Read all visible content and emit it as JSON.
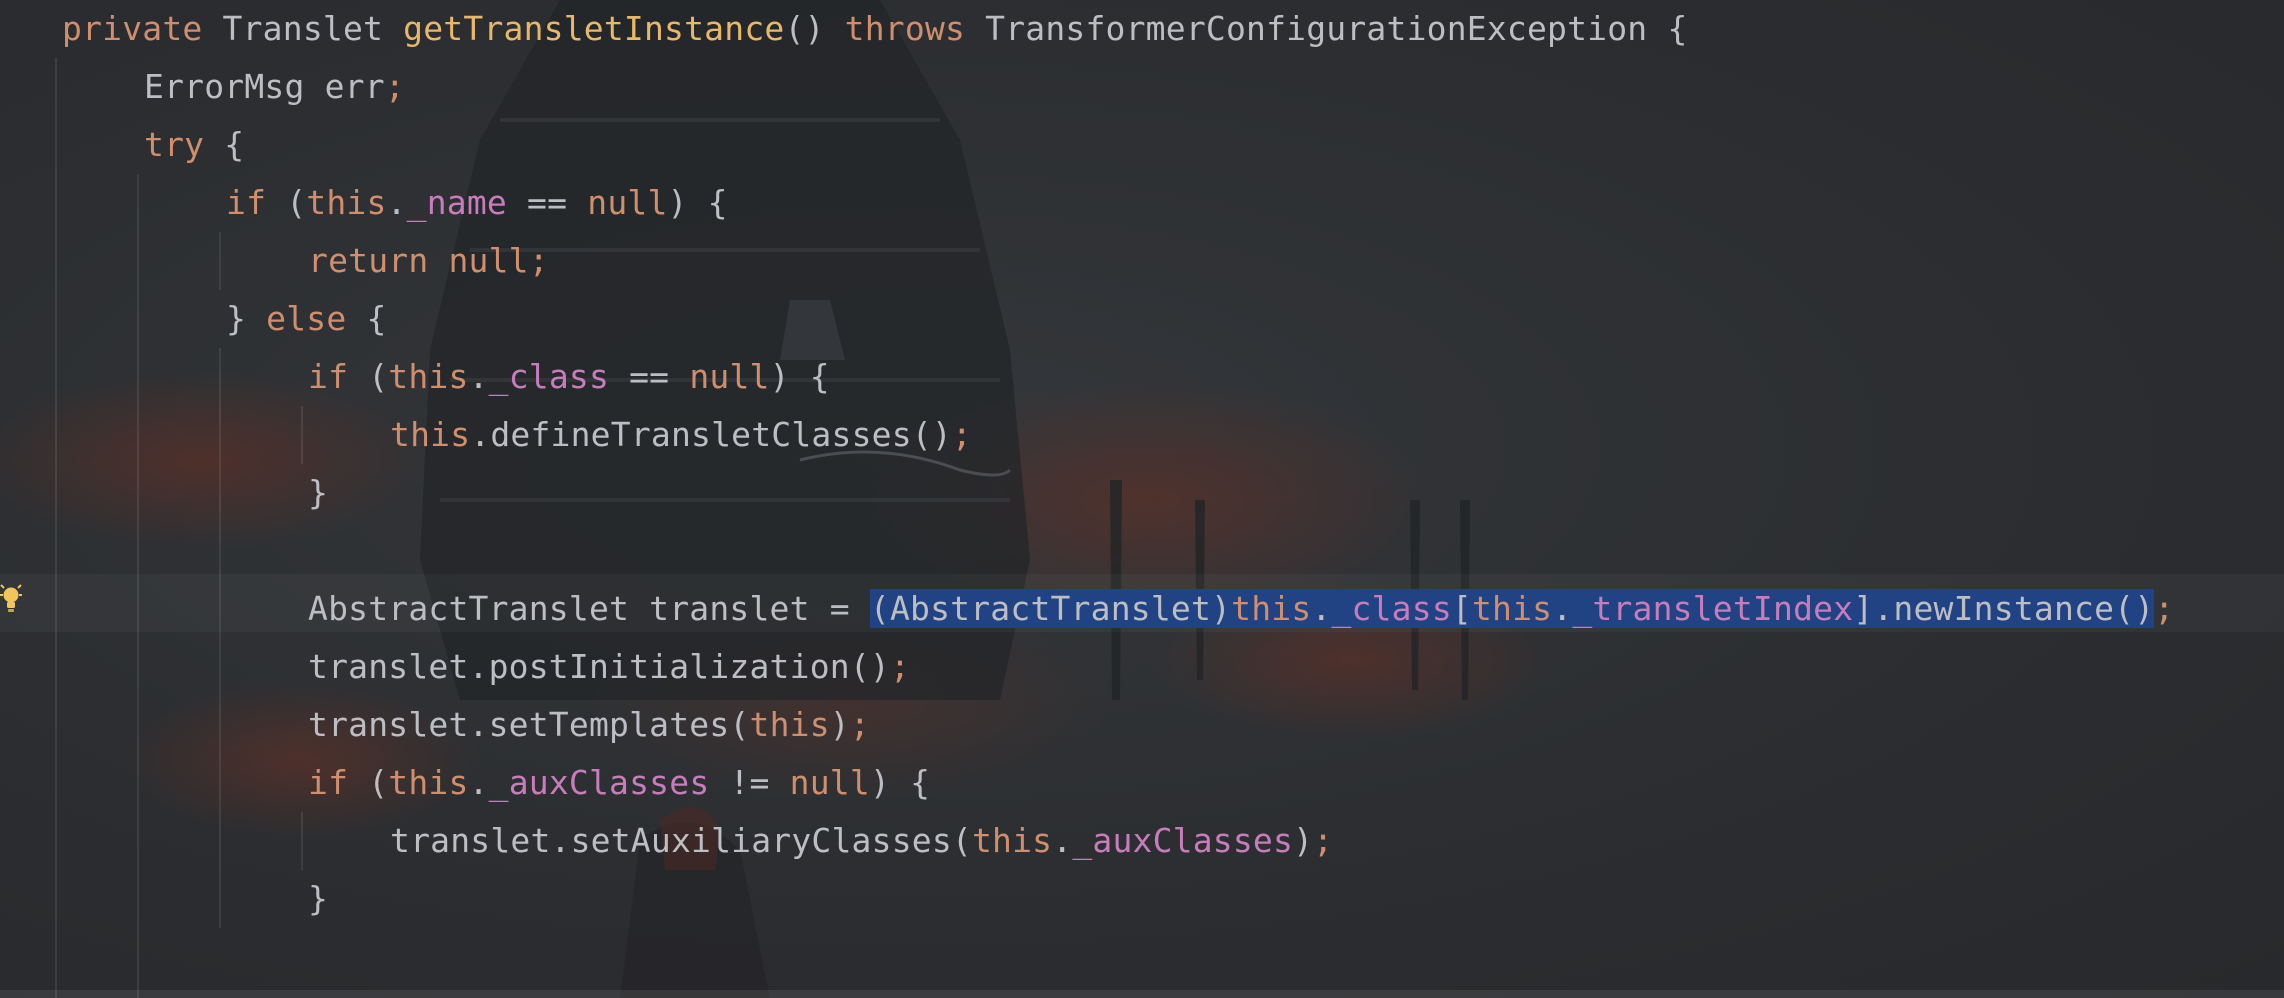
{
  "editor": {
    "language": "java",
    "colors": {
      "background": "#2b2d30",
      "keyword": "#cf8e6d",
      "method_decl": "#e8b86a",
      "field": "#c77dbb",
      "plain": "#bcbec4",
      "selection": "#214283"
    },
    "gutter_icon": "lightbulb-icon",
    "lines": [
      {
        "indent": 0,
        "tokens": [
          {
            "t": "private",
            "c": "kw"
          },
          {
            "t": " Translet ",
            "c": "txt"
          },
          {
            "t": "getTransletInstance",
            "c": "fnd"
          },
          {
            "t": "() ",
            "c": "txt"
          },
          {
            "t": "throws",
            "c": "kw"
          },
          {
            "t": " TransformerConfigurationException {",
            "c": "txt"
          }
        ]
      },
      {
        "indent": 1,
        "tokens": [
          {
            "t": "ErrorMsg err",
            "c": "txt"
          },
          {
            "t": ";",
            "c": "semi"
          }
        ]
      },
      {
        "indent": 1,
        "tokens": [
          {
            "t": "try",
            "c": "kw"
          },
          {
            "t": " {",
            "c": "txt"
          }
        ]
      },
      {
        "indent": 2,
        "tokens": [
          {
            "t": "if",
            "c": "kw"
          },
          {
            "t": " (",
            "c": "txt"
          },
          {
            "t": "this",
            "c": "kw"
          },
          {
            "t": ".",
            "c": "txt"
          },
          {
            "t": "_name",
            "c": "fld"
          },
          {
            "t": " == ",
            "c": "txt"
          },
          {
            "t": "null",
            "c": "kw"
          },
          {
            "t": ") {",
            "c": "txt"
          }
        ]
      },
      {
        "indent": 3,
        "tokens": [
          {
            "t": "return",
            "c": "kw"
          },
          {
            "t": " ",
            "c": "txt"
          },
          {
            "t": "null",
            "c": "kw"
          },
          {
            "t": ";",
            "c": "semi"
          }
        ]
      },
      {
        "indent": 2,
        "tokens": [
          {
            "t": "} ",
            "c": "txt"
          },
          {
            "t": "else",
            "c": "kw"
          },
          {
            "t": " {",
            "c": "txt"
          }
        ]
      },
      {
        "indent": 3,
        "tokens": [
          {
            "t": "if",
            "c": "kw"
          },
          {
            "t": " (",
            "c": "txt"
          },
          {
            "t": "this",
            "c": "kw"
          },
          {
            "t": ".",
            "c": "txt"
          },
          {
            "t": "_class",
            "c": "fld"
          },
          {
            "t": " == ",
            "c": "txt"
          },
          {
            "t": "null",
            "c": "kw"
          },
          {
            "t": ") {",
            "c": "txt"
          }
        ]
      },
      {
        "indent": 4,
        "tokens": [
          {
            "t": "this",
            "c": "kw"
          },
          {
            "t": ".defineTransletClasses()",
            "c": "txt"
          },
          {
            "t": ";",
            "c": "semi"
          }
        ]
      },
      {
        "indent": 3,
        "tokens": [
          {
            "t": "}",
            "c": "txt"
          }
        ]
      },
      {
        "indent": 0,
        "tokens": []
      },
      {
        "indent": 3,
        "current": true,
        "tokens": [
          {
            "t": "AbstractTranslet translet = ",
            "c": "txt"
          },
          {
            "t": "(AbstractTranslet)",
            "c": "txt",
            "sel": true
          },
          {
            "t": "this",
            "c": "kw",
            "sel": true
          },
          {
            "t": ".",
            "c": "txt",
            "sel": true
          },
          {
            "t": "_class",
            "c": "fld",
            "sel": true
          },
          {
            "t": "[",
            "c": "txt",
            "sel": true
          },
          {
            "t": "this",
            "c": "kw",
            "sel": true
          },
          {
            "t": ".",
            "c": "txt",
            "sel": true
          },
          {
            "t": "_transletIndex",
            "c": "fld",
            "sel": true
          },
          {
            "t": "].newInstance()",
            "c": "txt",
            "sel": true
          },
          {
            "t": ";",
            "c": "semi"
          }
        ]
      },
      {
        "indent": 3,
        "tokens": [
          {
            "t": "translet.postInitialization()",
            "c": "txt"
          },
          {
            "t": ";",
            "c": "semi"
          }
        ]
      },
      {
        "indent": 3,
        "tokens": [
          {
            "t": "translet.setTemplates(",
            "c": "txt"
          },
          {
            "t": "this",
            "c": "kw"
          },
          {
            "t": ")",
            "c": "txt"
          },
          {
            "t": ";",
            "c": "semi"
          }
        ]
      },
      {
        "indent": 3,
        "tokens": [
          {
            "t": "if",
            "c": "kw"
          },
          {
            "t": " (",
            "c": "txt"
          },
          {
            "t": "this",
            "c": "kw"
          },
          {
            "t": ".",
            "c": "txt"
          },
          {
            "t": "_auxClasses",
            "c": "fld"
          },
          {
            "t": " != ",
            "c": "txt"
          },
          {
            "t": "null",
            "c": "kw"
          },
          {
            "t": ") {",
            "c": "txt"
          }
        ]
      },
      {
        "indent": 4,
        "tokens": [
          {
            "t": "translet.setAuxiliaryClasses(",
            "c": "txt"
          },
          {
            "t": "this",
            "c": "kw"
          },
          {
            "t": ".",
            "c": "txt"
          },
          {
            "t": "_auxClasses",
            "c": "fld"
          },
          {
            "t": ")",
            "c": "txt"
          },
          {
            "t": ";",
            "c": "semi"
          }
        ]
      },
      {
        "indent": 3,
        "tokens": [
          {
            "t": "}",
            "c": "txt"
          }
        ]
      }
    ]
  }
}
